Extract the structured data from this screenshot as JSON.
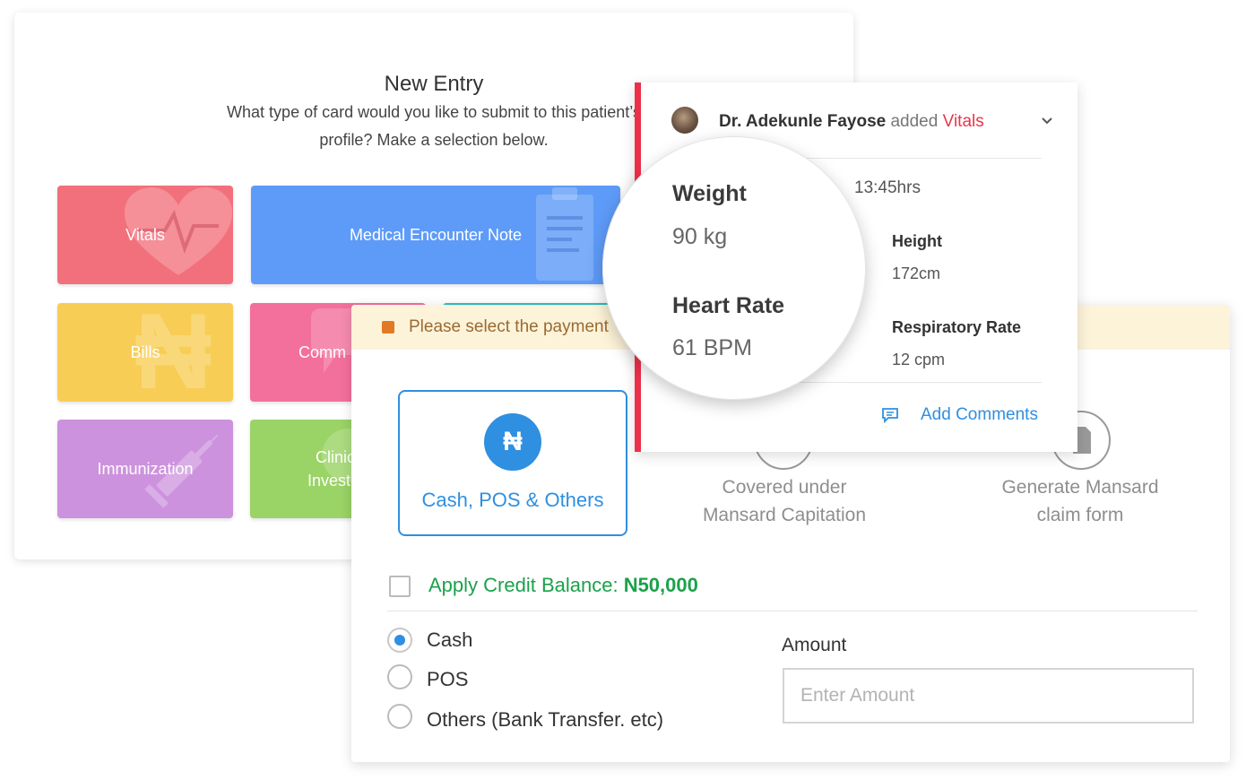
{
  "new_entry": {
    "title": "New Entry",
    "subtitle": "What type of card would you like to submit to this patient’s profile? Make a selection below.",
    "tiles": [
      {
        "label": "Vitals",
        "color": "#f2707c",
        "icon": "heart-pulse-icon"
      },
      {
        "label": "Medical Encounter Note",
        "color": "#5e9bf8",
        "icon": "clipboard-icon"
      },
      {
        "label": "Bills",
        "color": "#f8cd55",
        "icon": "naira-icon"
      },
      {
        "label": "Comm",
        "color": "#f36f9c",
        "icon": "chat-icon"
      },
      {
        "label": "Immunization",
        "color": "#cd92dd",
        "icon": "syringe-icon"
      },
      {
        "label": "Clinic Investig",
        "color": "#9ad366",
        "icon": "flask-icon"
      }
    ]
  },
  "vitals_card": {
    "author": "Dr. Adekunle Fayose",
    "action": "added",
    "card_type": "Vitals",
    "time": "13:45hrs",
    "weight_label": "Weight",
    "weight_value": "90 kg",
    "heart_label": "Heart Rate",
    "heart_value": "61 BPM",
    "height_label": "Height",
    "height_value": "172cm",
    "resp_label": "Respiratory Rate",
    "resp_value": "12 cpm",
    "comment_label": "Add Comments"
  },
  "payment": {
    "notice": "Please select the payment",
    "options": {
      "cash_label": "Cash, POS & Others",
      "capitation_line1": "Covered under",
      "capitation_line2": "Mansard Capitation",
      "claim_line1": "Generate Mansard",
      "claim_line2": "claim form"
    },
    "credit_label": "Apply Credit Balance:",
    "credit_amount": "N50,000",
    "methods": [
      "Cash",
      "POS",
      "Others (Bank Transfer. etc)"
    ],
    "selected_method": "Cash",
    "amount_label": "Amount",
    "amount_placeholder": "Enter Amount"
  },
  "colors": {
    "accent_blue": "#2f8fe0",
    "vitals_red": "#ee2f4a",
    "credit_green": "#1aa24a",
    "notice_bg": "#fdf3d9"
  }
}
